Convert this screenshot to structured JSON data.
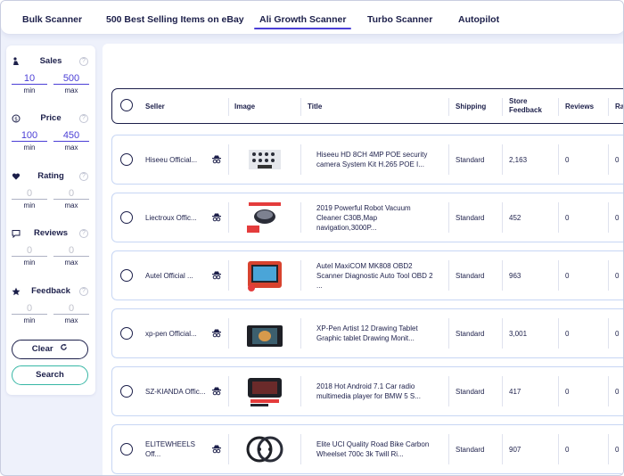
{
  "nav": {
    "tabs": [
      {
        "label": "Bulk Scanner"
      },
      {
        "label": "500 Best Selling Items on eBay"
      },
      {
        "label": "Ali Growth Scanner"
      },
      {
        "label": "Turbo Scanner"
      },
      {
        "label": "Autopilot"
      }
    ],
    "active_tab": "Ali Growth Scanner"
  },
  "filters": {
    "sales": {
      "title": "Sales",
      "min": "10",
      "max": "500",
      "min_label": "min",
      "max_label": "max"
    },
    "price": {
      "title": "Price",
      "min": "100",
      "max": "450",
      "min_label": "min",
      "max_label": "max"
    },
    "rating": {
      "title": "Rating",
      "min": "0",
      "max": "0",
      "min_label": "min",
      "max_label": "max"
    },
    "reviews": {
      "title": "Reviews",
      "min": "0",
      "max": "0",
      "min_label": "min",
      "max_label": "max"
    },
    "feedback": {
      "title": "Feedback",
      "min": "0",
      "max": "0",
      "min_label": "min",
      "max_label": "max"
    },
    "help": "?",
    "clear_label": "Clear",
    "search_label": "Search"
  },
  "table": {
    "columns": {
      "seller": "Seller",
      "image": "Image",
      "title": "Title",
      "shipping": "Shipping",
      "store_feedback_1": "Store",
      "store_feedback_2": "Feedback",
      "reviews": "Reviews",
      "rating": "Ra"
    },
    "rows": [
      {
        "seller": "Hiseeu Official...",
        "title1": "Hiseeu HD 8CH 4MP POE security",
        "title2": "camera System Kit H.265 POE I...",
        "shipping": "Standard",
        "store_feedback": "2,163",
        "reviews": "0",
        "rating": "0"
      },
      {
        "seller": "Liectroux Offic...",
        "title1": "2019 Powerful Robot Vacuum",
        "title2": "Cleaner C30B,Map",
        "title3": "navigation,3000P...",
        "shipping": "Standard",
        "store_feedback": "452",
        "reviews": "0",
        "rating": "0"
      },
      {
        "seller": "Autel Official ...",
        "title1": "Autel MaxiCOM MK808 OBD2",
        "title2": "Scanner Diagnostic Auto Tool OBD 2",
        "title3": "...",
        "shipping": "Standard",
        "store_feedback": "963",
        "reviews": "0",
        "rating": "0"
      },
      {
        "seller": "xp-pen Official...",
        "title1": "XP-Pen Artist 12 Drawing Tablet",
        "title2": "Graphic tablet Drawing Monit...",
        "shipping": "Standard",
        "store_feedback": "3,001",
        "reviews": "0",
        "rating": "0"
      },
      {
        "seller": "SZ-KIANDA Offic...",
        "title1": "2018 Hot Android 7.1 Car radio",
        "title2": "multimedia player for BMW 5 S...",
        "shipping": "Standard",
        "store_feedback": "417",
        "reviews": "0",
        "rating": "0"
      },
      {
        "seller": "ELITEWHEELS",
        "seller2": "Off...",
        "title1": "Elite UCI Quality Road Bike Carbon",
        "title2": "Wheelset 700c 3k Twill Ri...",
        "shipping": "Standard",
        "store_feedback": "907",
        "reviews": "0",
        "rating": "0"
      }
    ]
  },
  "colors": {
    "accent": "#4b3fd6",
    "teal": "#37b7a5",
    "text": "#1c1f4a"
  }
}
